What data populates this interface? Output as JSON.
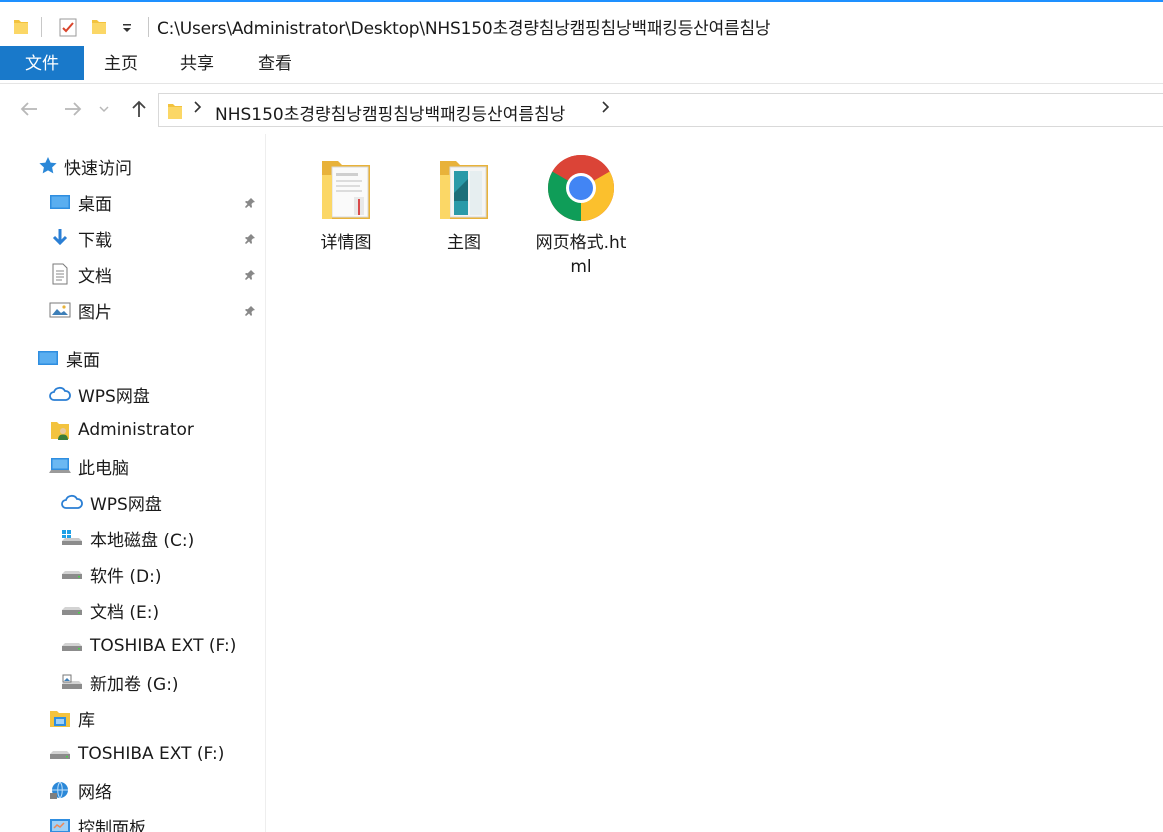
{
  "window": {
    "title_path": "C:\\Users\\Administrator\\Desktop\\NHS150초경량침낭캠핑침낭백패킹등산여름침낭",
    "quick_access_toolbar": [
      "folder-icon",
      "properties-icon",
      "new-folder-icon",
      "customize-dropdown-icon"
    ]
  },
  "ribbon": {
    "tabs": [
      "文件",
      "主页",
      "共享",
      "查看"
    ],
    "active_tab": "文件",
    "active_color": "#1979ca"
  },
  "address_bar": {
    "segments": [
      "NHS150초경량침낭캠핑침낭백패킹등산여름침낭"
    ]
  },
  "nav_tree": {
    "quick_access": {
      "label": "快速访问",
      "items": [
        {
          "label": "桌面",
          "icon": "desktop-icon",
          "pinned": true
        },
        {
          "label": "下载",
          "icon": "download-icon",
          "pinned": true
        },
        {
          "label": "文档",
          "icon": "document-icon",
          "pinned": true
        },
        {
          "label": "图片",
          "icon": "pictures-icon",
          "pinned": true
        }
      ]
    },
    "desktop": {
      "label": "桌面"
    },
    "wps_cloud": {
      "label": "WPS网盘"
    },
    "user": {
      "label": "Administrator"
    },
    "this_pc": {
      "label": "此电脑",
      "children": [
        {
          "label": "WPS网盘",
          "icon": "cloud-icon"
        },
        {
          "label": "本地磁盘 (C:)",
          "icon": "windows-drive-icon"
        },
        {
          "label": "软件 (D:)",
          "icon": "drive-icon"
        },
        {
          "label": "文档 (E:)",
          "icon": "drive-icon"
        },
        {
          "label": "TOSHIBA EXT (F:)",
          "icon": "drive-icon"
        },
        {
          "label": "新加卷 (G:)",
          "icon": "drive-icon"
        }
      ]
    },
    "libraries": {
      "label": "库"
    },
    "toshiba": {
      "label": "TOSHIBA EXT (F:)"
    },
    "network": {
      "label": "网络"
    },
    "control_panel": {
      "label": "控制面板"
    }
  },
  "files": [
    {
      "name": "详情图",
      "type": "folder"
    },
    {
      "name": "主图",
      "type": "folder"
    },
    {
      "name": "网页格式.html",
      "type": "chrome-html"
    }
  ]
}
